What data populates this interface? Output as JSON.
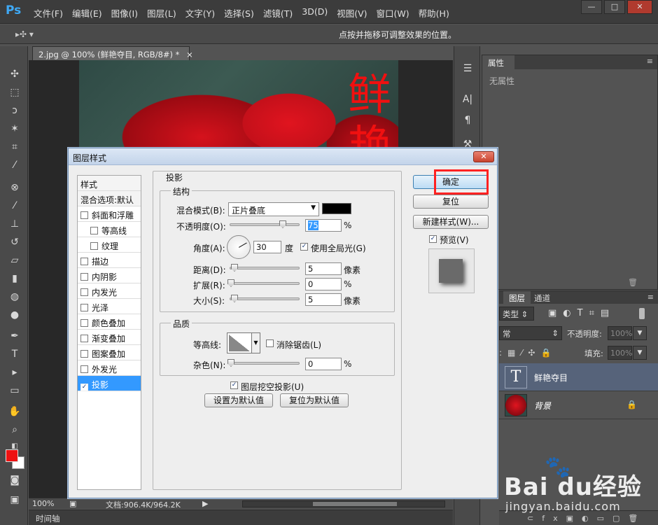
{
  "app": {
    "logo": "Ps"
  },
  "menu": {
    "items": [
      "文件(F)",
      "编辑(E)",
      "图像(I)",
      "图层(L)",
      "文字(Y)",
      "选择(S)",
      "滤镜(T)",
      "3D(D)",
      "视图(V)",
      "窗口(W)",
      "帮助(H)"
    ]
  },
  "window_controls": {
    "minimize": "—",
    "maximize": "□",
    "close": "✕"
  },
  "options_bar": {
    "tool_glyph": "▸✣ ▾",
    "hint": "点按并拖移可调整效果的位置。"
  },
  "document": {
    "tab_title": "2.jpg @ 100% (鲜艳夺目, RGB/8#) *",
    "tab_close": "×",
    "canvas_char_1": "鲜",
    "canvas_char_2": "艳"
  },
  "status": {
    "zoom": "100%",
    "doc_info": "文档:906.4K/964.2K",
    "timeline": "时间轴"
  },
  "properties": {
    "tab": "属性",
    "empty_text": "无属性"
  },
  "layers": {
    "tabs": [
      "图层",
      "通道"
    ],
    "filter_label": "类型",
    "blend_mode": "常",
    "opacity_label": "不透明度:",
    "opacity_value": "100%",
    "fill_label": "填充:",
    "fill_value": "100%",
    "text_thumb": "T",
    "items": [
      {
        "name": "鲜艳夺目",
        "selected": true
      },
      {
        "name": "背景",
        "locked": true
      }
    ]
  },
  "watermark": {
    "brand": "Bai du经验",
    "url": "jingyan.baidu.com"
  },
  "dialog": {
    "title": "图层样式",
    "close_glyph": "✕",
    "styles": [
      {
        "label": "样式",
        "kind": "header"
      },
      {
        "label": "混合选项:默认",
        "kind": "header"
      },
      {
        "label": "斜面和浮雕",
        "checked": false
      },
      {
        "label": "等高线",
        "checked": false,
        "indent": true
      },
      {
        "label": "纹理",
        "checked": false,
        "indent": true
      },
      {
        "label": "描边",
        "checked": false
      },
      {
        "label": "内阴影",
        "checked": false
      },
      {
        "label": "内发光",
        "checked": false
      },
      {
        "label": "光泽",
        "checked": false
      },
      {
        "label": "颜色叠加",
        "checked": false
      },
      {
        "label": "渐变叠加",
        "checked": false
      },
      {
        "label": "图案叠加",
        "checked": false
      },
      {
        "label": "外发光",
        "checked": false
      },
      {
        "label": "投影",
        "checked": true,
        "selected": true
      }
    ],
    "section_title": "投影",
    "structure": {
      "title": "结构",
      "blend_mode_label": "混合模式(B):",
      "blend_mode_value": "正片叠底",
      "shadow_color": "#000000",
      "opacity_label": "不透明度(O):",
      "opacity_value": "75",
      "opacity_unit": "%",
      "angle_label": "角度(A):",
      "angle_value": "30",
      "angle_unit": "度",
      "global_light_label": "使用全局光(G)",
      "global_light_checked": true,
      "distance_label": "距离(D):",
      "distance_value": "5",
      "distance_unit": "像素",
      "spread_label": "扩展(R):",
      "spread_value": "0",
      "spread_unit": "%",
      "size_label": "大小(S):",
      "size_value": "5",
      "size_unit": "像素"
    },
    "quality": {
      "title": "品质",
      "contour_label": "等高线:",
      "antialias_label": "消除锯齿(L)",
      "antialias_checked": false,
      "noise_label": "杂色(N):",
      "noise_value": "0",
      "noise_unit": "%"
    },
    "knockout_label": "图层挖空投影(U)",
    "knockout_checked": true,
    "make_default": "设置为默认值",
    "reset_default": "复位为默认值",
    "ok": "确定",
    "reset": "复位",
    "new_style": "新建样式(W)...",
    "preview_label": "预览(V)",
    "preview_checked": true,
    "check_glyph": "✓"
  }
}
